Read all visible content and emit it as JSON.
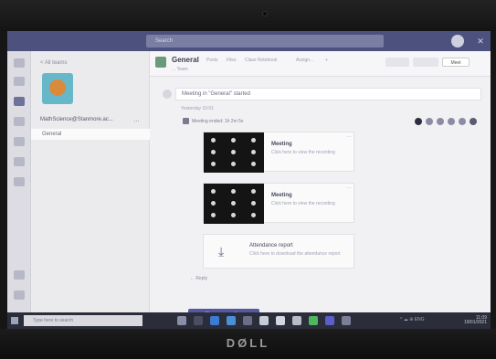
{
  "brand": "DØLL",
  "titlebar": {
    "search_placeholder": "Search"
  },
  "teams_panel": {
    "back_label": "< All teams",
    "team_name": "MathScience@Stanmore.ac...",
    "team_more": "...",
    "channel_label": "General"
  },
  "channel": {
    "title": "General",
    "tabs": [
      "Posts",
      "Files",
      "Class Notebook",
      "Assign..."
    ],
    "add_tab": "+",
    "sub": "... Team",
    "meet_label": "Meet"
  },
  "post": {
    "text": "Meeting in \"General\" started",
    "meta": "Yesterday 10:01",
    "meeting_started": "Meeting ended: 1h 2m 5s"
  },
  "cards": [
    {
      "title": "Meeting",
      "sub": "Click here to view the recording"
    },
    {
      "title": "Meeting",
      "sub": "Click here to view the recording"
    }
  ],
  "file_card": {
    "title": "Attendance report",
    "sub": "Click here to download the attendance report"
  },
  "reply_label": "← Reply",
  "new_conversation": "New conversation",
  "taskbar": {
    "search_placeholder": "Type here to search",
    "tray_text": "^ ☁ ⊕ ENG",
    "time": "11:09",
    "date": "19/01/2021"
  }
}
